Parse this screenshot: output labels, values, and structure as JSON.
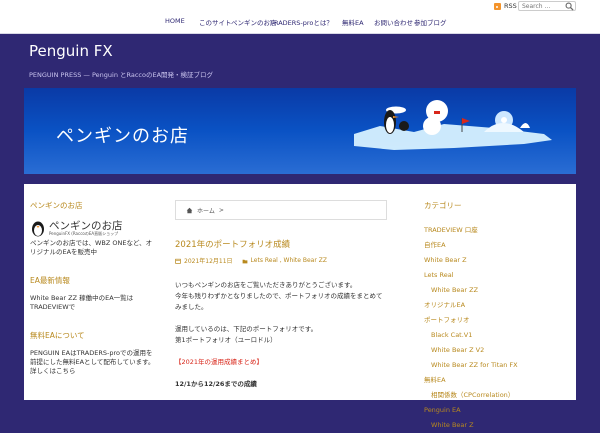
{
  "topbar": {
    "rss_label": "RSS",
    "search_placeholder": "Search ..."
  },
  "nav": {
    "items": [
      "HOME",
      "このサイト",
      "ペンギンのお店",
      "TRADERS-proとは？",
      "無料EA",
      "お問い合わせ",
      "参加ブログ"
    ]
  },
  "header": {
    "site_title": "Penguin FX",
    "site_description": "PENGUIN PRESS — Penguin とRaccoのEA開発・検証ブログ",
    "banner_text": "ペンギンのお店"
  },
  "left_sidebar": {
    "shop_heading": "ペンギンのお店",
    "shop_name": "ペンギンのお店",
    "shop_subtitle": "PenguinFX (RaccoのEA直販ショップ",
    "shop_text": "ペンギンのお店では、WBZ ONEなど、オリジナルのEAを販売中",
    "ea_heading": "EA最新情報",
    "ea_text": "White Bear ZZ 稼働中のEA一覧はTRADEVIEWで",
    "free_heading": "無料EAについて",
    "free_text": "PENGUIN EAはTRADERS-proでの運用を前提にした無料EAとして配布しています。詳しくはこちら"
  },
  "breadcrumb": {
    "home": "ホーム",
    "separator": ">"
  },
  "post": {
    "title": "2021年のポートフォリオ成績",
    "date": "2021年12月11日",
    "tags": "Lets Real , White Bear ZZ",
    "paragraphs": [
      "いつもペンギンのお店をご覧いただきありがとうございます。",
      "今年も残りわずかとなりましたので、ポートフォリオの成績をまとめてみました。",
      "",
      "運用しているのは、下記のポートフォリオです。",
      "第1ポートフォリオ（ユーロドル）"
    ],
    "red_note": "【2021年の運用成績まとめ】",
    "bold_line": "12/1から12/26までの成績"
  },
  "right_sidebar": {
    "heading": "カテゴリー",
    "categories": [
      {
        "label": "TRADEVIEW 口座",
        "sub": false
      },
      {
        "label": "自作EA",
        "sub": false
      },
      {
        "label": "White Bear Z",
        "sub": false
      },
      {
        "label": "Lets Real",
        "sub": false
      },
      {
        "label": "White Bear ZZ",
        "sub": true
      },
      {
        "label": "オリジナルEA",
        "sub": false
      },
      {
        "label": "ポートフォリオ",
        "sub": false
      },
      {
        "label": "Black Cat.V1",
        "sub": true
      },
      {
        "label": "White Bear Z V2",
        "sub": true
      },
      {
        "label": "White Bear ZZ for Titan FX",
        "sub": true
      },
      {
        "label": "無料EA",
        "sub": false
      },
      {
        "label": "相関係数（CPCorrelation）",
        "sub": true
      },
      {
        "label": "Penguin EA",
        "sub": false
      },
      {
        "label": "White Bear Z",
        "sub": true
      }
    ]
  },
  "colors": {
    "header_bg": "#2f2873",
    "accent": "#b8891e",
    "note_red": "#d8261a"
  }
}
